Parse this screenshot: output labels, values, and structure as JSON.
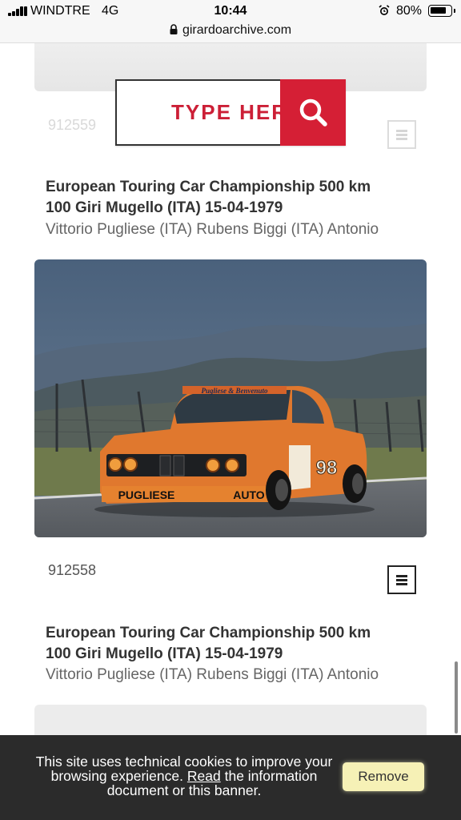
{
  "status_bar": {
    "carrier": "WINDTRE",
    "network": "4G",
    "time": "10:44",
    "battery": "80%",
    "battery_level": 0.8
  },
  "browser": {
    "url": "girardoarchive.com"
  },
  "search": {
    "placeholder": "TYPE HERE",
    "accent_color": "#d51f35"
  },
  "cards": [
    {
      "code": "912559",
      "title_line1": "European Touring Car Championship 500 km",
      "title_line2": "100 Giri Mugello (ITA) 15-04-1979",
      "drivers": "Vittorio Pugliese (ITA) Rubens Biggi (ITA) Antonio"
    },
    {
      "code": "912558",
      "title_line1": "European Touring Car Championship 500 km",
      "title_line2": "100 Giri Mugello (ITA) 15-04-1979",
      "drivers": "Vittorio Pugliese (ITA) Rubens Biggi (ITA) Antonio",
      "photo": {
        "livery_top": "Pugliese & Benvenuto",
        "car_number": "98",
        "bumper_left": "PUGLIESE",
        "bumper_right": "AUTO",
        "body_color": "#e0782e"
      }
    }
  ],
  "cookie_banner": {
    "text_before": "This site uses technical cookies to improve your browsing experience.",
    "link": "Read",
    "text_after": "the information document or this banner.",
    "button": "Remove"
  }
}
